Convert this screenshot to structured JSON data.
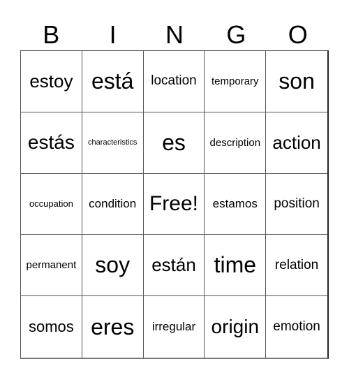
{
  "header": {
    "letters": [
      "B",
      "I",
      "N",
      "G",
      "O"
    ]
  },
  "card": {
    "rows": [
      [
        "estoy",
        "está",
        "location",
        "temporary",
        "son"
      ],
      [
        "estás",
        "characteristics",
        "es",
        "description",
        "action"
      ],
      [
        "occupation",
        "condition",
        "Free!",
        "estamos",
        "position"
      ],
      [
        "permanent",
        "soy",
        "están",
        "time",
        "relation"
      ],
      [
        "somos",
        "eres",
        "irregular",
        "origin",
        "emotion"
      ]
    ],
    "free_space": "Free!"
  }
}
